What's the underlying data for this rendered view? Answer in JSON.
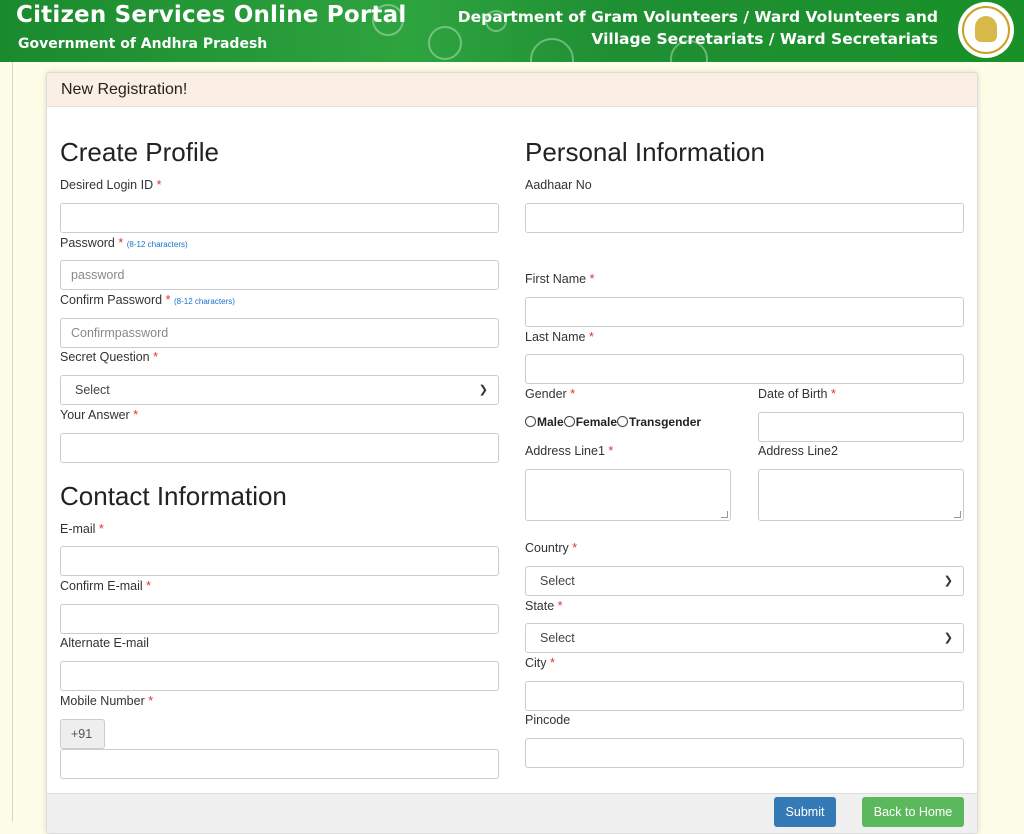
{
  "header": {
    "portal_title": "Citizen Services Online Portal",
    "portal_subtitle": "Government of Andhra Pradesh",
    "dept_line1": "Department of Gram Volunteers / Ward Volunteers and",
    "dept_line2": "Village Secretariats / Ward Secretariats"
  },
  "panel": {
    "title": "New Registration!"
  },
  "create_profile": {
    "heading": "Create Profile",
    "login_id_label": "Desired Login ID",
    "password_label": "Password",
    "password_hint": "(8-12 characters)",
    "password_placeholder": "password",
    "confirm_password_label": "Confirm Password",
    "confirm_password_hint": "(8-12 characters)",
    "confirm_password_placeholder": "Confirmpassword",
    "secret_question_label": "Secret Question",
    "secret_question_value": "Select",
    "answer_label": "Your Answer"
  },
  "contact": {
    "heading": "Contact Information",
    "email_label": "E-mail",
    "confirm_email_label": "Confirm E-mail",
    "alt_email_label": "Alternate E-mail",
    "mobile_label": "Mobile Number",
    "country_code": "+91"
  },
  "personal": {
    "heading": "Personal Information",
    "aadhaar_label": "Aadhaar No",
    "first_name_label": "First Name",
    "last_name_label": "Last Name",
    "gender_label": "Gender",
    "gender_options": [
      "Male",
      "Female",
      "Transgender"
    ],
    "dob_label": "Date of Birth",
    "address1_label": "Address Line1",
    "address2_label": "Address Line2",
    "country_label": "Country",
    "country_value": "Select",
    "state_label": "State",
    "state_value": "Select",
    "city_label": "City",
    "pincode_label": "Pincode"
  },
  "actions": {
    "submit": "Submit",
    "back": "Back to Home"
  },
  "colors": {
    "header_green": "#2ea43f",
    "panel_head": "#fbeee4",
    "required": "#d33",
    "submit": "#337ab7",
    "back": "#5cb85c"
  }
}
